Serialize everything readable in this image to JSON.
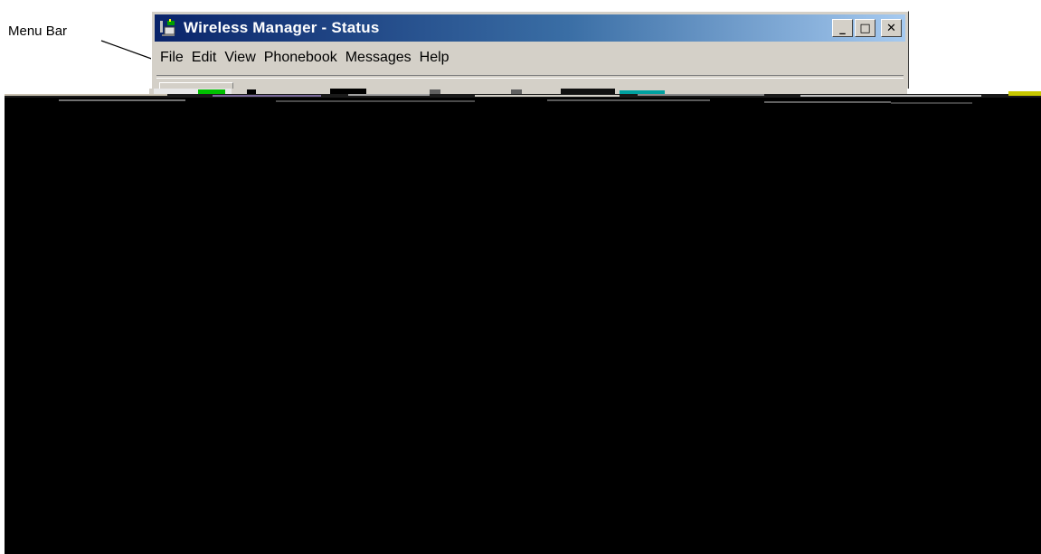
{
  "callout": {
    "label": "Menu Bar"
  },
  "window": {
    "title": "Wireless Manager - Status",
    "caption_buttons": {
      "minimize": "_",
      "maximize": "□",
      "close": "✕"
    }
  },
  "menu": {
    "items": [
      {
        "label": "File"
      },
      {
        "label": "Edit"
      },
      {
        "label": "View"
      },
      {
        "label": "Phonebook"
      },
      {
        "label": "Messages"
      },
      {
        "label": "Help"
      }
    ]
  },
  "icons": {
    "app": "wireless-app-icon",
    "minimize": "minimize-icon",
    "maximize": "maximize-icon",
    "close": "close-icon"
  },
  "colors": {
    "titlebar_start": "#0a246a",
    "titlebar_end": "#a6caf0",
    "window_face": "#d4d0c8",
    "content_background": "#000000"
  }
}
